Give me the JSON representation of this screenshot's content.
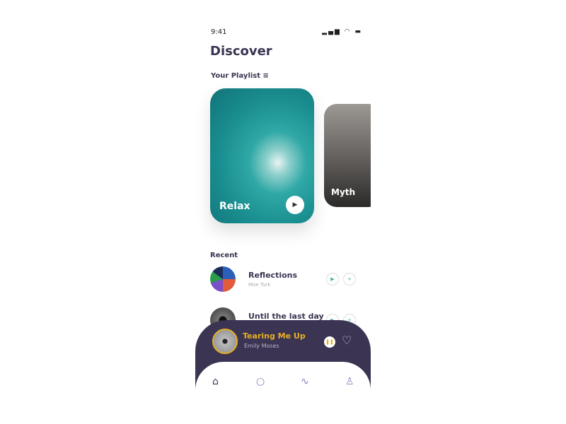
{
  "status": {
    "time": "9:41",
    "icons": "signal wifi battery"
  },
  "header": {
    "title": "Discover",
    "playlist_label": "Your Playlist",
    "playlist_icon": "queue-music-icon"
  },
  "playlists": [
    {
      "name": "Relax"
    },
    {
      "name": "Myth"
    }
  ],
  "recent": {
    "label": "Recent",
    "items": [
      {
        "title": "Reflections",
        "artist": "Moe Turk"
      },
      {
        "title": "Until the last day",
        "artist": ""
      }
    ]
  },
  "player": {
    "title": "Tearing Me Up",
    "artist": "Emily Moses",
    "accent": "#e8b021",
    "bg": "#3b3452"
  },
  "nav": [
    "home",
    "search",
    "activity",
    "profile"
  ]
}
